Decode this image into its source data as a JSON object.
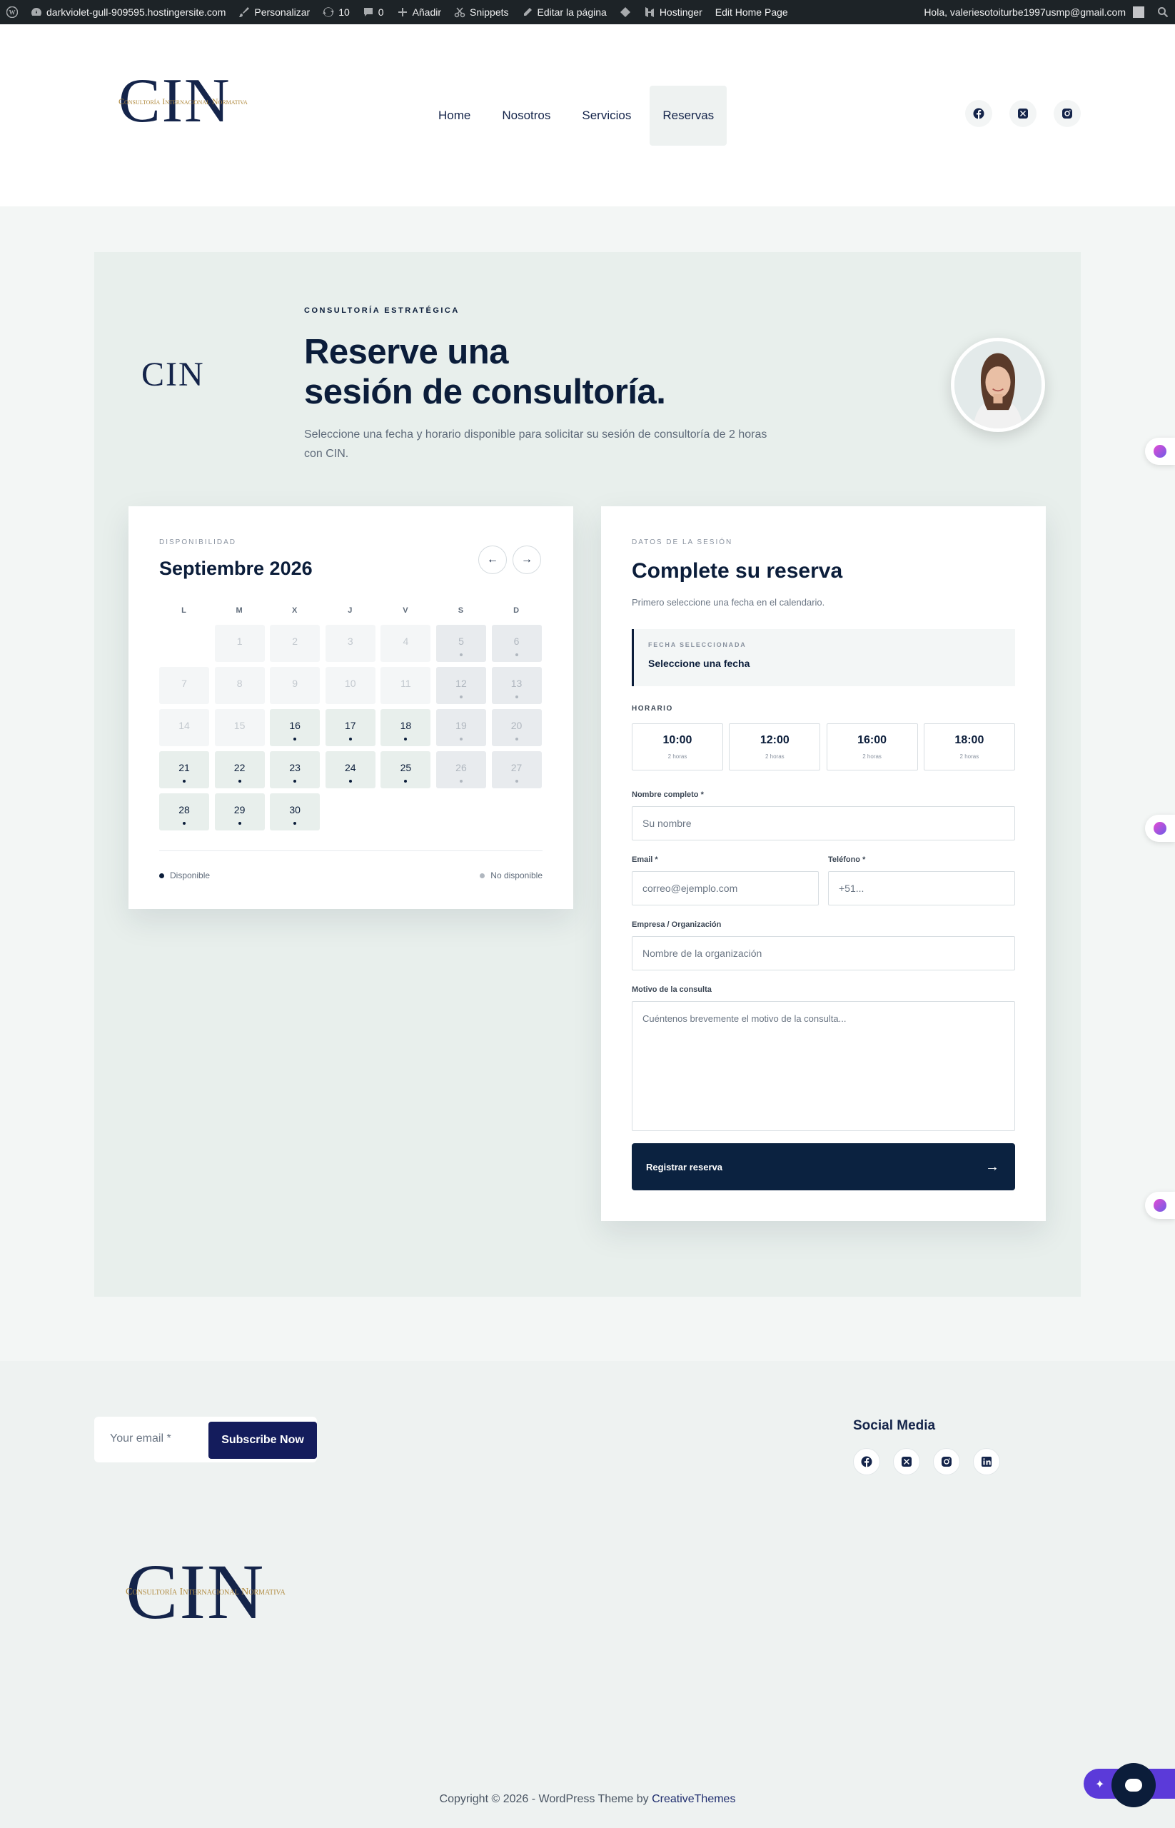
{
  "admin_bar": {
    "site": "darkviolet-gull-909595.hostingersite.com",
    "customize": "Personalizar",
    "updates": "10",
    "comments": "0",
    "add_new": "Añadir",
    "snippets": "Snippets",
    "edit_page": "Editar la página",
    "hostinger": "Hostinger",
    "edit_home": "Edit Home Page",
    "greeting": "Hola, valeriesotoiturbe1997usmp@gmail.com"
  },
  "header": {
    "logo_text": "CIN",
    "logo_sub": "Consultoría Internacional Normativa",
    "nav": [
      "Home",
      "Nosotros",
      "Servicios",
      "Reservas"
    ],
    "active_nav": "Reservas",
    "social_icons": [
      "facebook-icon",
      "x-twitter-icon",
      "instagram-icon"
    ]
  },
  "hero": {
    "logo_text": "CIN",
    "eyebrow": "CONSULTORÍA ESTRATÉGICA",
    "title_line1": "Reserve una",
    "title_line2": "sesión de consultoría.",
    "description": "Seleccione una fecha y horario disponible para solicitar su sesión de consultoría de 2 horas con CIN."
  },
  "calendar": {
    "eyebrow": "DISPONIBILIDAD",
    "month": "Septiembre 2026",
    "prev": "←",
    "next": "→",
    "weekdays": [
      "L",
      "M",
      "X",
      "J",
      "V",
      "S",
      "D"
    ],
    "legend_available": "Disponible",
    "legend_unavailable": "No disponible",
    "offset": 1,
    "days": [
      {
        "n": "1",
        "s": "past"
      },
      {
        "n": "2",
        "s": "past"
      },
      {
        "n": "3",
        "s": "past"
      },
      {
        "n": "4",
        "s": "past"
      },
      {
        "n": "5",
        "s": "unav"
      },
      {
        "n": "6",
        "s": "unav"
      },
      {
        "n": "7",
        "s": "past"
      },
      {
        "n": "8",
        "s": "past"
      },
      {
        "n": "9",
        "s": "past"
      },
      {
        "n": "10",
        "s": "past"
      },
      {
        "n": "11",
        "s": "past"
      },
      {
        "n": "12",
        "s": "unav"
      },
      {
        "n": "13",
        "s": "unav"
      },
      {
        "n": "14",
        "s": "past"
      },
      {
        "n": "15",
        "s": "past"
      },
      {
        "n": "16",
        "s": "avail"
      },
      {
        "n": "17",
        "s": "avail"
      },
      {
        "n": "18",
        "s": "avail"
      },
      {
        "n": "19",
        "s": "unav"
      },
      {
        "n": "20",
        "s": "unav"
      },
      {
        "n": "21",
        "s": "avail"
      },
      {
        "n": "22",
        "s": "avail"
      },
      {
        "n": "23",
        "s": "avail"
      },
      {
        "n": "24",
        "s": "avail"
      },
      {
        "n": "25",
        "s": "avail"
      },
      {
        "n": "26",
        "s": "unav"
      },
      {
        "n": "27",
        "s": "unav"
      },
      {
        "n": "28",
        "s": "avail"
      },
      {
        "n": "29",
        "s": "avail"
      },
      {
        "n": "30",
        "s": "avail"
      }
    ]
  },
  "form": {
    "eyebrow": "DATOS DE LA SESIÓN",
    "title": "Complete su reserva",
    "hint": "Primero seleccione una fecha en el calendario.",
    "selected_label": "FECHA SELECCIONADA",
    "selected_value": "Seleccione una fecha",
    "horario_label": "HORARIO",
    "slots": [
      {
        "time": "10:00",
        "dur": "2 horas"
      },
      {
        "time": "12:00",
        "dur": "2 horas"
      },
      {
        "time": "16:00",
        "dur": "2 horas"
      },
      {
        "time": "18:00",
        "dur": "2 horas"
      }
    ],
    "name_label": "Nombre completo *",
    "name_placeholder": "Su nombre",
    "email_label": "Email *",
    "email_placeholder": "correo@ejemplo.com",
    "phone_label": "Teléfono *",
    "phone_placeholder": "+51...",
    "org_label": "Empresa / Organización",
    "org_placeholder": "Nombre de la organización",
    "reason_label": "Motivo de la consulta",
    "reason_placeholder": "Cuéntenos brevemente el motivo de la consulta...",
    "submit": "Registrar reserva",
    "submit_arrow": "→"
  },
  "footer": {
    "email_placeholder": "Your email *",
    "subscribe": "Subscribe Now",
    "social_title": "Social Media",
    "social_icons": [
      "facebook-icon",
      "x-twitter-icon",
      "instagram-icon",
      "linkedin-icon"
    ],
    "logo_text": "CIN",
    "logo_sub": "Consultoría Internacional Normativa",
    "copyright_prefix": "Copyright © 2026 - WordPress Theme by ",
    "copyright_link": "CreativeThemes"
  },
  "colors": {
    "navy": "#0b1d3a",
    "brand_blue": "#141c5c",
    "hero_bg": "#e8efec",
    "gold": "#b08a3e",
    "widget_purple": "#5b3ad9"
  }
}
